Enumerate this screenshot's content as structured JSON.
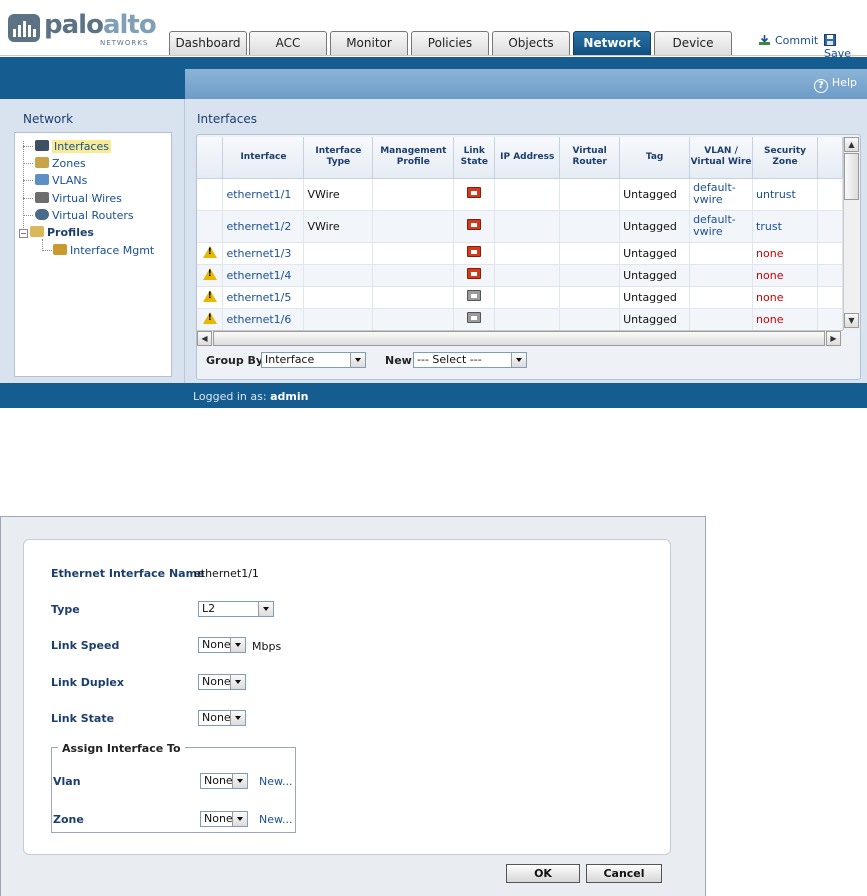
{
  "header": {
    "logo_main": "palo",
    "logo_accent": "alto",
    "logo_sub": "NETWORKS",
    "tabs": [
      {
        "label": "Dashboard"
      },
      {
        "label": "ACC"
      },
      {
        "label": "Monitor"
      },
      {
        "label": "Policies"
      },
      {
        "label": "Objects"
      },
      {
        "label": "Network",
        "active": true
      },
      {
        "label": "Device"
      }
    ],
    "commit_label": "Commit",
    "save_label": "Save",
    "help_label": "Help"
  },
  "sidebar": {
    "title": "Network",
    "items": [
      {
        "label": "Interfaces",
        "icon": "interfaces-icon",
        "selected": true
      },
      {
        "label": "Zones",
        "icon": "zones-icon"
      },
      {
        "label": "VLANs",
        "icon": "vlans-icon"
      },
      {
        "label": "Virtual Wires",
        "icon": "virtual-wires-icon"
      },
      {
        "label": "Virtual Routers",
        "icon": "virtual-routers-icon"
      },
      {
        "label": "Profiles",
        "icon": "profiles-folder-icon",
        "expanded": true
      },
      {
        "label": "Interface Mgmt",
        "icon": "interface-mgmt-icon"
      }
    ]
  },
  "main": {
    "title": "Interfaces",
    "columns": [
      "",
      "Interface",
      "Interface Type",
      "Management Profile",
      "Link State",
      "IP Address",
      "Virtual Router",
      "Tag",
      "VLAN / Virtual Wire",
      "Security Zone",
      ""
    ],
    "rows": [
      {
        "warning": false,
        "interface": "ethernet1/1",
        "type": "VWire",
        "mgmt": "",
        "link": "up",
        "ip": "",
        "vr": "",
        "tag": "Untagged",
        "vlan": "default-vwire",
        "zone": "untrust"
      },
      {
        "warning": false,
        "interface": "ethernet1/2",
        "type": "VWire",
        "mgmt": "",
        "link": "up",
        "ip": "",
        "vr": "",
        "tag": "Untagged",
        "vlan": "default-vwire",
        "zone": "trust"
      },
      {
        "warning": true,
        "interface": "ethernet1/3",
        "type": "",
        "mgmt": "",
        "link": "up",
        "ip": "",
        "vr": "",
        "tag": "Untagged",
        "vlan": "",
        "zone": "none"
      },
      {
        "warning": true,
        "interface": "ethernet1/4",
        "type": "",
        "mgmt": "",
        "link": "up",
        "ip": "",
        "vr": "",
        "tag": "Untagged",
        "vlan": "",
        "zone": "none"
      },
      {
        "warning": true,
        "interface": "ethernet1/5",
        "type": "",
        "mgmt": "",
        "link": "down",
        "ip": "",
        "vr": "",
        "tag": "Untagged",
        "vlan": "",
        "zone": "none"
      },
      {
        "warning": true,
        "interface": "ethernet1/6",
        "type": "",
        "mgmt": "",
        "link": "down",
        "ip": "",
        "vr": "",
        "tag": "Untagged",
        "vlan": "",
        "zone": "none"
      }
    ],
    "group_by_label": "Group By",
    "group_by_value": "Interface",
    "new_label": "New",
    "new_value": "--- Select ---"
  },
  "status": {
    "prefix": "Logged in as:",
    "user": "admin"
  },
  "dialog": {
    "name_label": "Ethernet Interface Name",
    "name_value": "ethernet1/1",
    "type_label": "Type",
    "type_value": "L2",
    "speed_label": "Link Speed",
    "speed_value": "None",
    "speed_unit": "Mbps",
    "duplex_label": "Link Duplex",
    "duplex_value": "None",
    "state_label": "Link State",
    "state_value": "None",
    "assign_legend": "Assign Interface To",
    "vlan_label": "Vlan",
    "vlan_value": "None",
    "zone_label": "Zone",
    "zone_value": "None",
    "new_link": "New...",
    "ok_label": "OK",
    "cancel_label": "Cancel"
  },
  "colors": {
    "brand_blue": "#155c91",
    "link_blue": "#1a4f96",
    "warning_yellow": "#e6b800",
    "error_red": "#cc0000"
  }
}
